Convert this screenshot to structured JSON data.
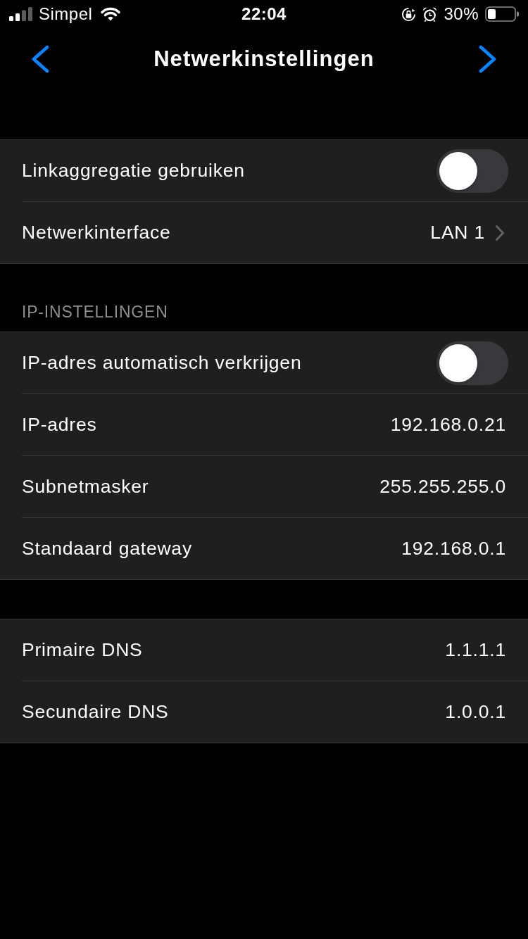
{
  "status_bar": {
    "carrier": "Simpel",
    "time": "22:04",
    "battery": "30%"
  },
  "nav_bar": {
    "title": "Netwerkinstellingen"
  },
  "sections": [
    {
      "rows": [
        {
          "kind": "toggle",
          "label": "Linkaggregatie gebruiken",
          "on": false
        },
        {
          "kind": "disclosure",
          "label": "Netwerkinterface",
          "value": "LAN 1"
        }
      ]
    },
    {
      "header": "IP-INSTELLINGEN",
      "rows": [
        {
          "kind": "toggle",
          "label": "IP-adres automatisch verkrijgen",
          "on": false
        },
        {
          "kind": "value",
          "label": "IP-adres",
          "value": "192.168.0.21"
        },
        {
          "kind": "value",
          "label": "Subnetmasker",
          "value": "255.255.255.0"
        },
        {
          "kind": "value",
          "label": "Standaard gateway",
          "value": "192.168.0.1"
        }
      ]
    },
    {
      "rows": [
        {
          "kind": "value",
          "label": "Primaire DNS",
          "value": "1.1.1.1"
        },
        {
          "kind": "value",
          "label": "Secundaire DNS",
          "value": "1.0.0.1"
        }
      ]
    }
  ]
}
